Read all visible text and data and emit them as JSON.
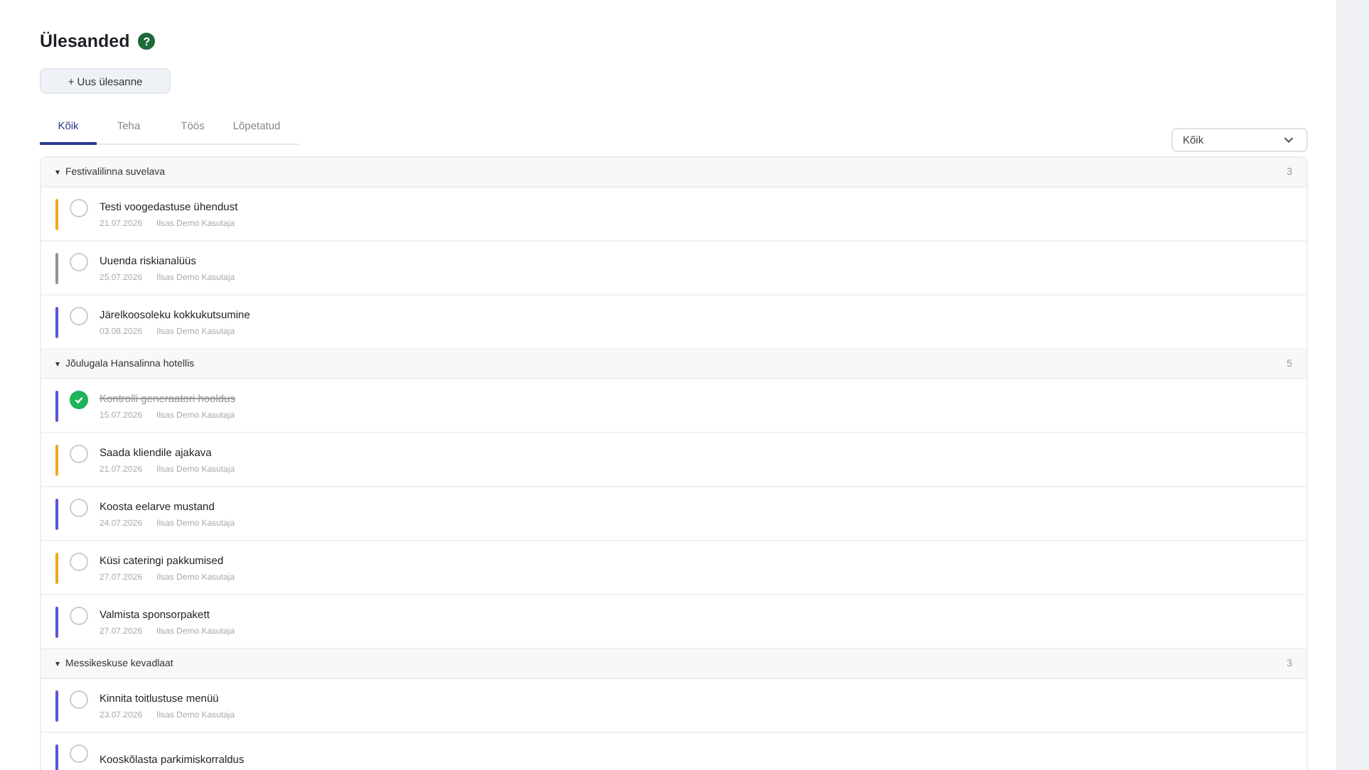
{
  "page": {
    "title": "Ülesanded",
    "help": "?"
  },
  "new_button": "+ Uus ülesanne",
  "tabs": [
    {
      "label": "Kõik",
      "selected": true
    },
    {
      "label": "Teha",
      "selected": false
    },
    {
      "label": "Töös",
      "selected": false
    },
    {
      "label": "Lõpetatud",
      "selected": false
    }
  ],
  "filter": {
    "value": "Kõik"
  },
  "groups": [
    {
      "name": "Festivalilinna suvelava",
      "count": "3",
      "caret": "▾",
      "expanded": true,
      "tasks": [
        {
          "title": "Testi voogedastuse ühendust",
          "date": "21.07.2026",
          "assignee": "Ilsas Demo Kasutaja",
          "color": "#f0a81c",
          "done": false
        },
        {
          "title": "Uuenda riskianalüüs",
          "date": "25.07.2026",
          "assignee": "Ilsas Demo Kasutaja",
          "color": "#8c968f",
          "done": false
        },
        {
          "title": "Järelkoosoleku kokkukutsumine",
          "date": "03.08.2026",
          "assignee": "Ilsas Demo Kasutaja",
          "color": "#5b55d9",
          "done": false
        }
      ]
    },
    {
      "name": "Jõulugala Hansalinna hotellis",
      "count": "5",
      "caret": "▾",
      "expanded": true,
      "tasks": [
        {
          "title": "Kontrolli generaatori hooldus",
          "date": "15.07.2026",
          "assignee": "Ilsas Demo Kasutaja",
          "color": "#5b55d9",
          "done": true
        },
        {
          "title": "Saada kliendile ajakava",
          "date": "21.07.2026",
          "assignee": "Ilsas Demo Kasutaja",
          "color": "#f0a81c",
          "done": false
        },
        {
          "title": "Koosta eelarve mustand",
          "date": "24.07.2026",
          "assignee": "Ilsas Demo Kasutaja",
          "color": "#5b55d9",
          "done": false
        },
        {
          "title": "Küsi cateringi pakkumised",
          "date": "27.07.2026",
          "assignee": "Ilsas Demo Kasutaja",
          "color": "#f0a81c",
          "done": false
        },
        {
          "title": "Valmista sponsorpakett",
          "date": "27.07.2026",
          "assignee": "Ilsas Demo Kasutaja",
          "color": "#5b55d9",
          "done": false
        }
      ]
    },
    {
      "name": "Messikeskuse kevadlaat",
      "count": "3",
      "caret": "▾",
      "expanded": true,
      "tasks": [
        {
          "title": "Kinnita toitlustuse menüü",
          "date": "23.07.2026",
          "assignee": "Ilsas Demo Kasutaja",
          "color": "#5b55d9",
          "done": false
        },
        {
          "title": "Kooskõlasta parkimiskorraldus",
          "color": "#5b55d9",
          "done": false
        }
      ]
    }
  ]
}
